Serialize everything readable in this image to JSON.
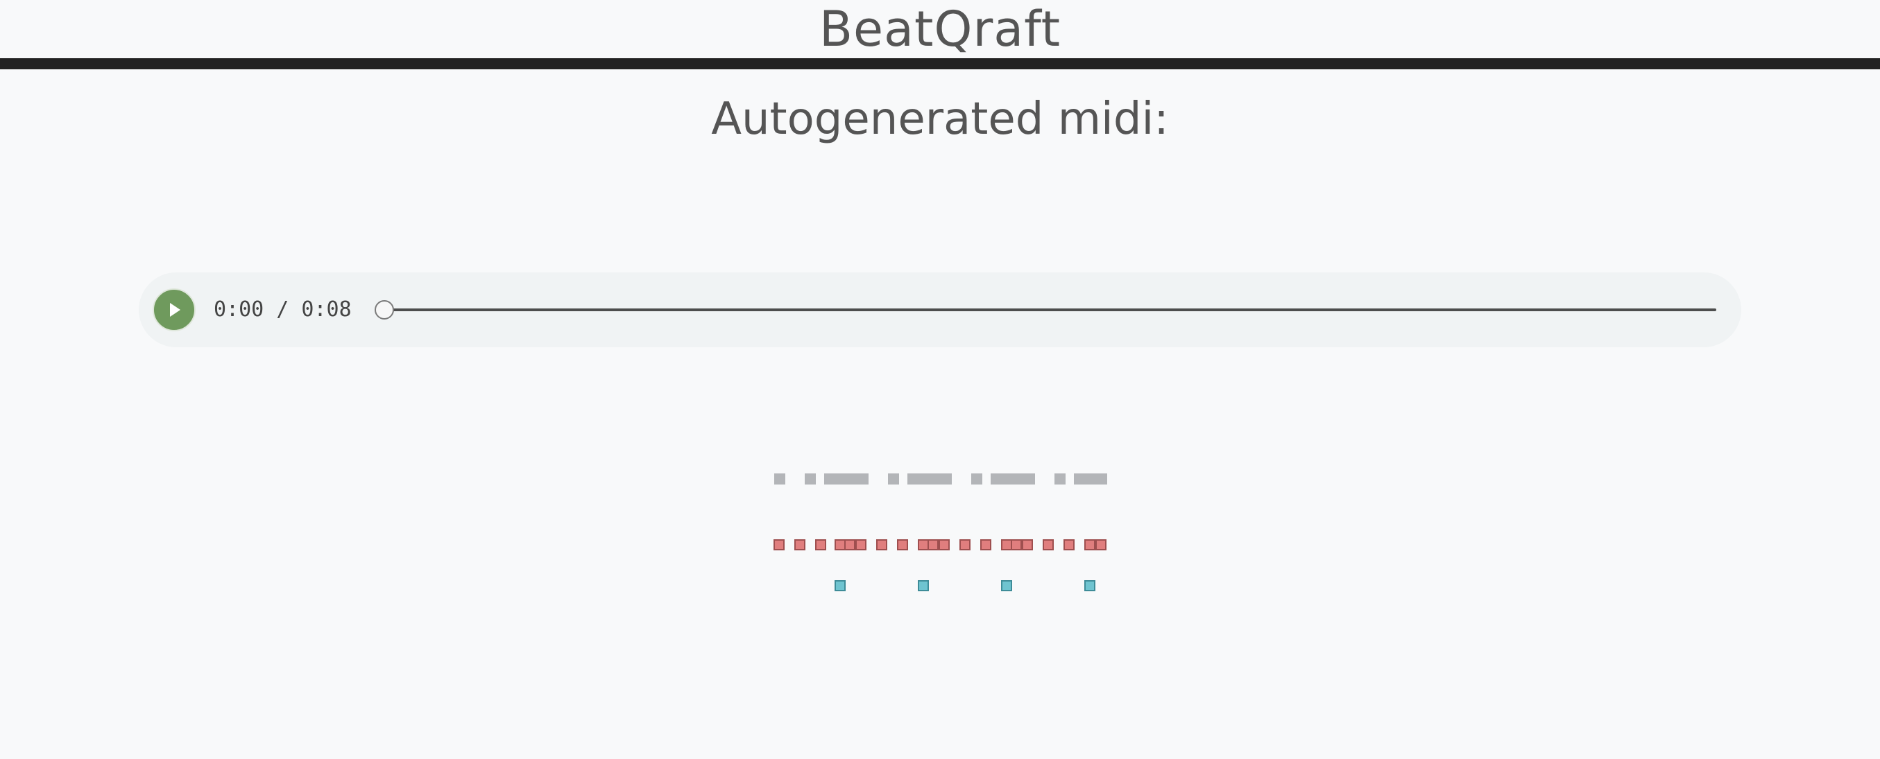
{
  "app": {
    "title": "BeatQraft"
  },
  "main": {
    "heading": "Autogenerated midi:"
  },
  "player": {
    "time": "0:00 / 0:08",
    "progress": 0,
    "play_icon": "play-icon",
    "colors": {
      "play_button": "#6f9a5d",
      "track": "#4d4d4d",
      "background": "#f0f3f4"
    }
  },
  "visualizer": {
    "colors": {
      "gray": "#b3b5b8",
      "red": "#e07e7e",
      "teal": "#6fc4d0"
    }
  }
}
